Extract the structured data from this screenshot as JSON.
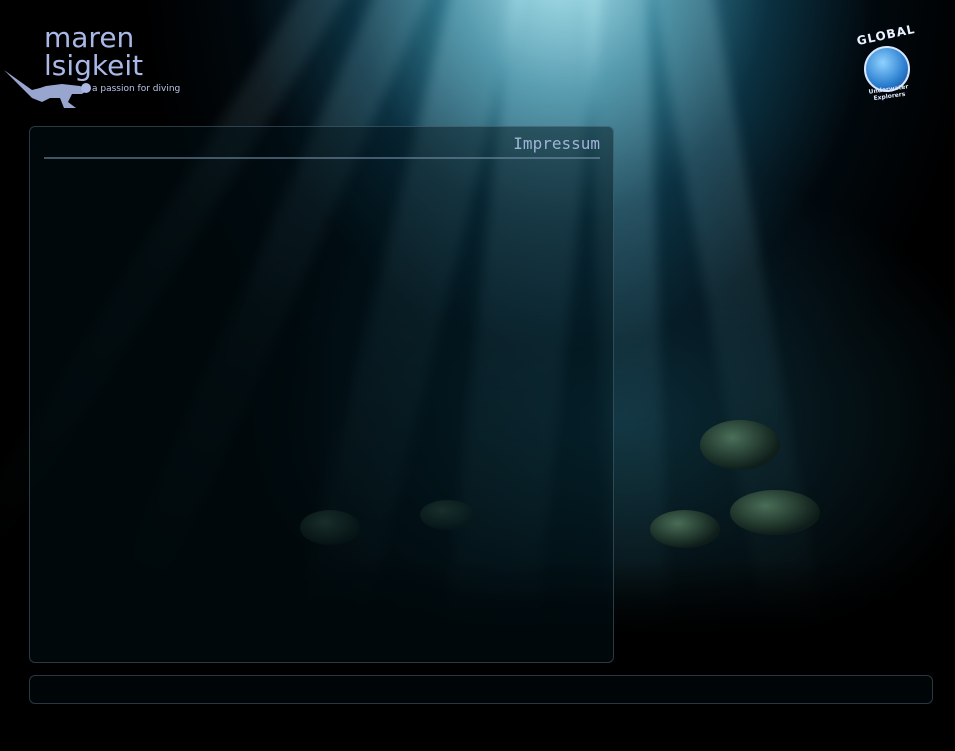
{
  "logo": {
    "line1": "maren",
    "line2": "lsigkeit",
    "tagline": "a passion for diving"
  },
  "badge": {
    "top_text": "GLOBAL",
    "bottom_text": "Underwater Explorers"
  },
  "panel": {
    "title": "Impressum"
  },
  "colors": {
    "panel_title": "#9fb4d8",
    "logo_text": "#a9b8e6",
    "background": "#000000"
  }
}
